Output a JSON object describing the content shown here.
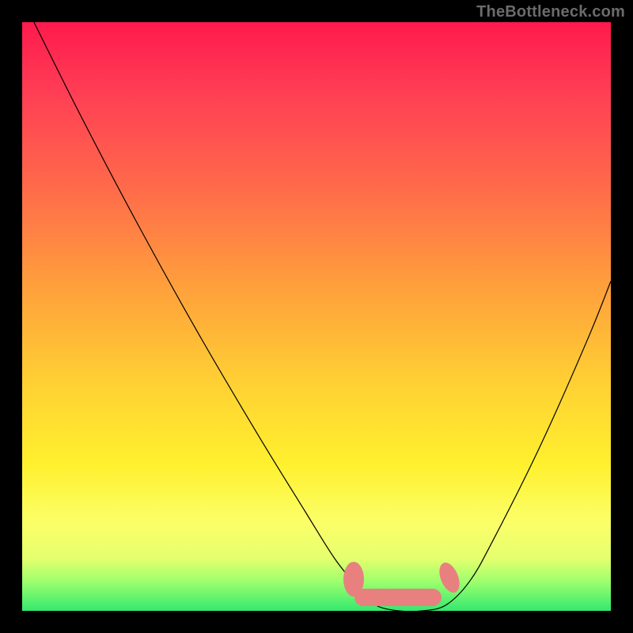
{
  "watermark": "TheBottleneck.com",
  "chart_data": {
    "type": "line",
    "title": "",
    "xlabel": "",
    "ylabel": "",
    "xlim": [
      0,
      100
    ],
    "ylim": [
      0,
      100
    ],
    "grid": false,
    "legend": false,
    "series": [
      {
        "name": "bottleneck-curve",
        "x": [
          2,
          10,
          20,
          30,
          40,
          48,
          53,
          57,
          60,
          64,
          68,
          72,
          76,
          80,
          88,
          96,
          100
        ],
        "y": [
          100,
          84,
          65,
          47,
          30,
          17,
          9,
          4,
          1,
          0,
          0,
          1,
          5,
          12,
          28,
          46,
          56
        ]
      }
    ],
    "highlight_band": {
      "name": "optimal-range",
      "x_start": 55,
      "x_end": 74,
      "color": "#e98080"
    },
    "gradient_stops": [
      {
        "pos": 0.0,
        "color": "#ff1a4d"
      },
      {
        "pos": 0.28,
        "color": "#ff6a4a"
      },
      {
        "pos": 0.62,
        "color": "#ffd233"
      },
      {
        "pos": 0.85,
        "color": "#fbff68"
      },
      {
        "pos": 1.0,
        "color": "#33e96f"
      }
    ]
  }
}
